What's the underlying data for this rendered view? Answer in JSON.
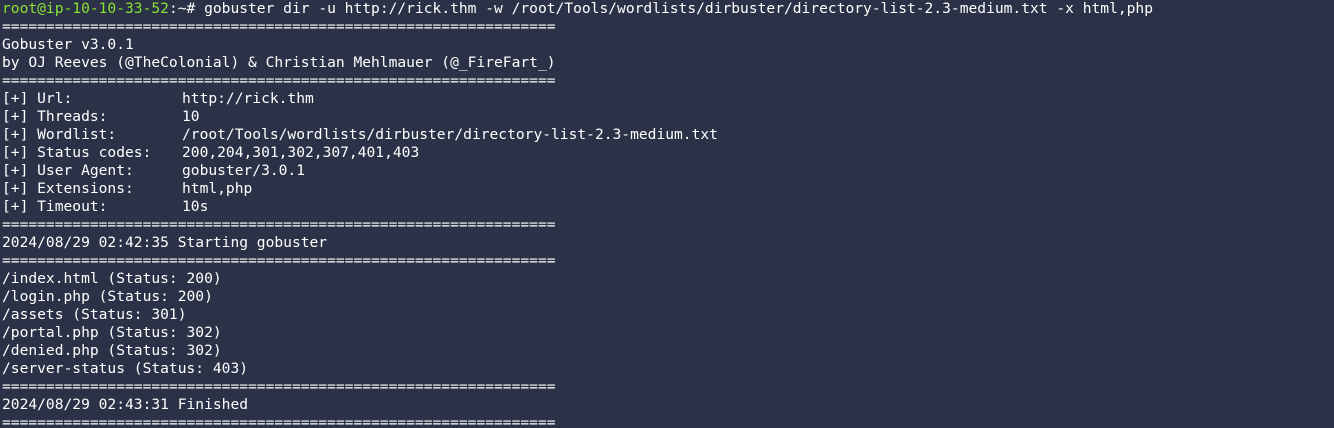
{
  "prompt": {
    "user_host": "root@ip-10-10-33-52",
    "path": ":~# ",
    "command": "gobuster dir -u http://rick.thm -w /root/Tools/wordlists/dirbuster/directory-list-2.3-medium.txt -x html,php"
  },
  "separator": "===============================================================",
  "banner": {
    "version": "Gobuster v3.0.1",
    "authors": "by OJ Reeves (@TheColonial) & Christian Mehlmauer (@_FireFart_)"
  },
  "config": [
    {
      "key": "[+] Url:",
      "value": "http://rick.thm"
    },
    {
      "key": "[+] Threads:",
      "value": "10"
    },
    {
      "key": "[+] Wordlist:",
      "value": "/root/Tools/wordlists/dirbuster/directory-list-2.3-medium.txt"
    },
    {
      "key": "[+] Status codes:",
      "value": "200,204,301,302,307,401,403"
    },
    {
      "key": "[+] User Agent:",
      "value": "gobuster/3.0.1"
    },
    {
      "key": "[+] Extensions:",
      "value": "html,php"
    },
    {
      "key": "[+] Timeout:",
      "value": "10s"
    }
  ],
  "start_msg": "2024/08/29 02:42:35 Starting gobuster",
  "results": [
    "/index.html (Status: 200)",
    "/login.php (Status: 200)",
    "/assets (Status: 301)",
    "/portal.php (Status: 302)",
    "/denied.php (Status: 302)",
    "/server-status (Status: 403)"
  ],
  "finish_msg": "2024/08/29 02:43:31 Finished",
  "colors": {
    "background": "#2b3146",
    "prompt_user": "#8ae234",
    "text": "#ffffff"
  }
}
